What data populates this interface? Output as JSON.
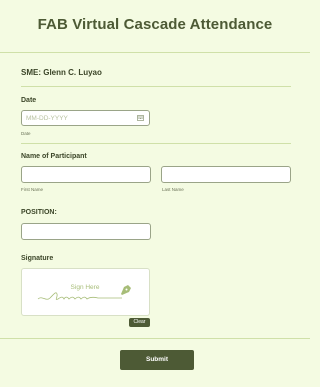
{
  "form": {
    "title": "FAB Virtual Cascade Attendance",
    "sme": "SME: Glenn C. Luyao",
    "date": {
      "label": "Date",
      "placeholder": "MM-DD-YYYY",
      "sublabel": "Date"
    },
    "participant": {
      "label": "Name of Participant",
      "first_sublabel": "First Name",
      "last_sublabel": "Last Name"
    },
    "position": {
      "label": "POSITION:"
    },
    "signature": {
      "label": "Signature",
      "prompt": "Sign Here",
      "clear_label": "Clear"
    },
    "submit_label": "Submit"
  },
  "icons": {
    "calendar": "calendar-icon",
    "pen": "pen-icon"
  },
  "colors": {
    "background": "#f4fbe2",
    "accent": "#4d5a35",
    "divider": "#cfe0a8"
  }
}
